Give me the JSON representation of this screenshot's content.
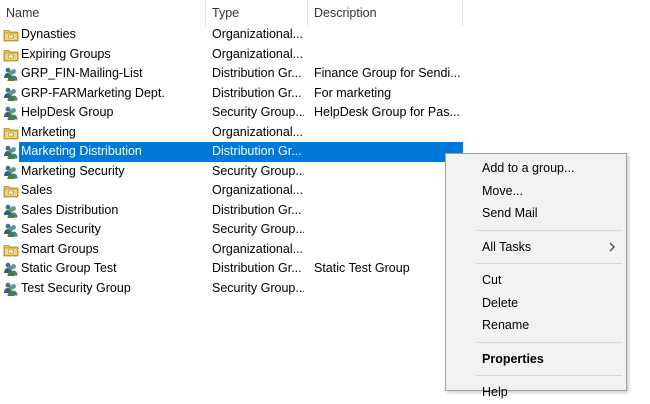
{
  "columns": {
    "name": "Name",
    "type": "Type",
    "description": "Description"
  },
  "rows": [
    {
      "icon": "ou-folder-icon",
      "name": "Dynasties",
      "type": "Organizational...",
      "description": ""
    },
    {
      "icon": "ou-folder-icon",
      "name": "Expiring Groups",
      "type": "Organizational...",
      "description": ""
    },
    {
      "icon": "group-icon",
      "name": "GRP_FIN-Mailing-List",
      "type": "Distribution Gr...",
      "description": "Finance Group for Sendi..."
    },
    {
      "icon": "group-icon",
      "name": "GRP-FARMarketing Dept.",
      "type": "Distribution Gr...",
      "description": "For marketing"
    },
    {
      "icon": "group-icon",
      "name": "HelpDesk Group",
      "type": "Security Group...",
      "description": "HelpDesk Group for Pas..."
    },
    {
      "icon": "ou-folder-icon",
      "name": "Marketing",
      "type": "Organizational...",
      "description": ""
    },
    {
      "icon": "group-icon",
      "name": "Marketing Distribution",
      "type": "Distribution Gr...",
      "description": "",
      "selected": true
    },
    {
      "icon": "group-icon",
      "name": "Marketing Security",
      "type": "Security Group...",
      "description": ""
    },
    {
      "icon": "ou-folder-icon",
      "name": "Sales",
      "type": "Organizational...",
      "description": ""
    },
    {
      "icon": "group-icon",
      "name": "Sales Distribution",
      "type": "Distribution Gr...",
      "description": ""
    },
    {
      "icon": "group-icon",
      "name": "Sales Security",
      "type": "Security Group...",
      "description": ""
    },
    {
      "icon": "ou-folder-icon",
      "name": "Smart Groups",
      "type": "Organizational...",
      "description": ""
    },
    {
      "icon": "group-icon",
      "name": "Static Group Test",
      "type": "Distribution Gr...",
      "description": "Static Test Group"
    },
    {
      "icon": "group-icon",
      "name": "Test Security Group",
      "type": "Security Group...",
      "description": ""
    }
  ],
  "context_menu": {
    "items": [
      {
        "label": "Add to a group...",
        "name": "menu-add-to-group"
      },
      {
        "label": "Move...",
        "name": "menu-move"
      },
      {
        "label": "Send Mail",
        "name": "menu-send-mail"
      },
      {
        "separator": true
      },
      {
        "label": "All Tasks",
        "name": "menu-all-tasks",
        "submenu": true
      },
      {
        "separator": true
      },
      {
        "label": "Cut",
        "name": "menu-cut"
      },
      {
        "label": "Delete",
        "name": "menu-delete"
      },
      {
        "label": "Rename",
        "name": "menu-rename"
      },
      {
        "separator": true
      },
      {
        "label": "Properties",
        "name": "menu-properties",
        "bold": true
      },
      {
        "separator": true
      },
      {
        "label": "Help",
        "name": "menu-help"
      }
    ]
  },
  "colors": {
    "selection": "#0078d7",
    "menu_bg": "#f2f2f2",
    "folder": "#e8c15a"
  }
}
